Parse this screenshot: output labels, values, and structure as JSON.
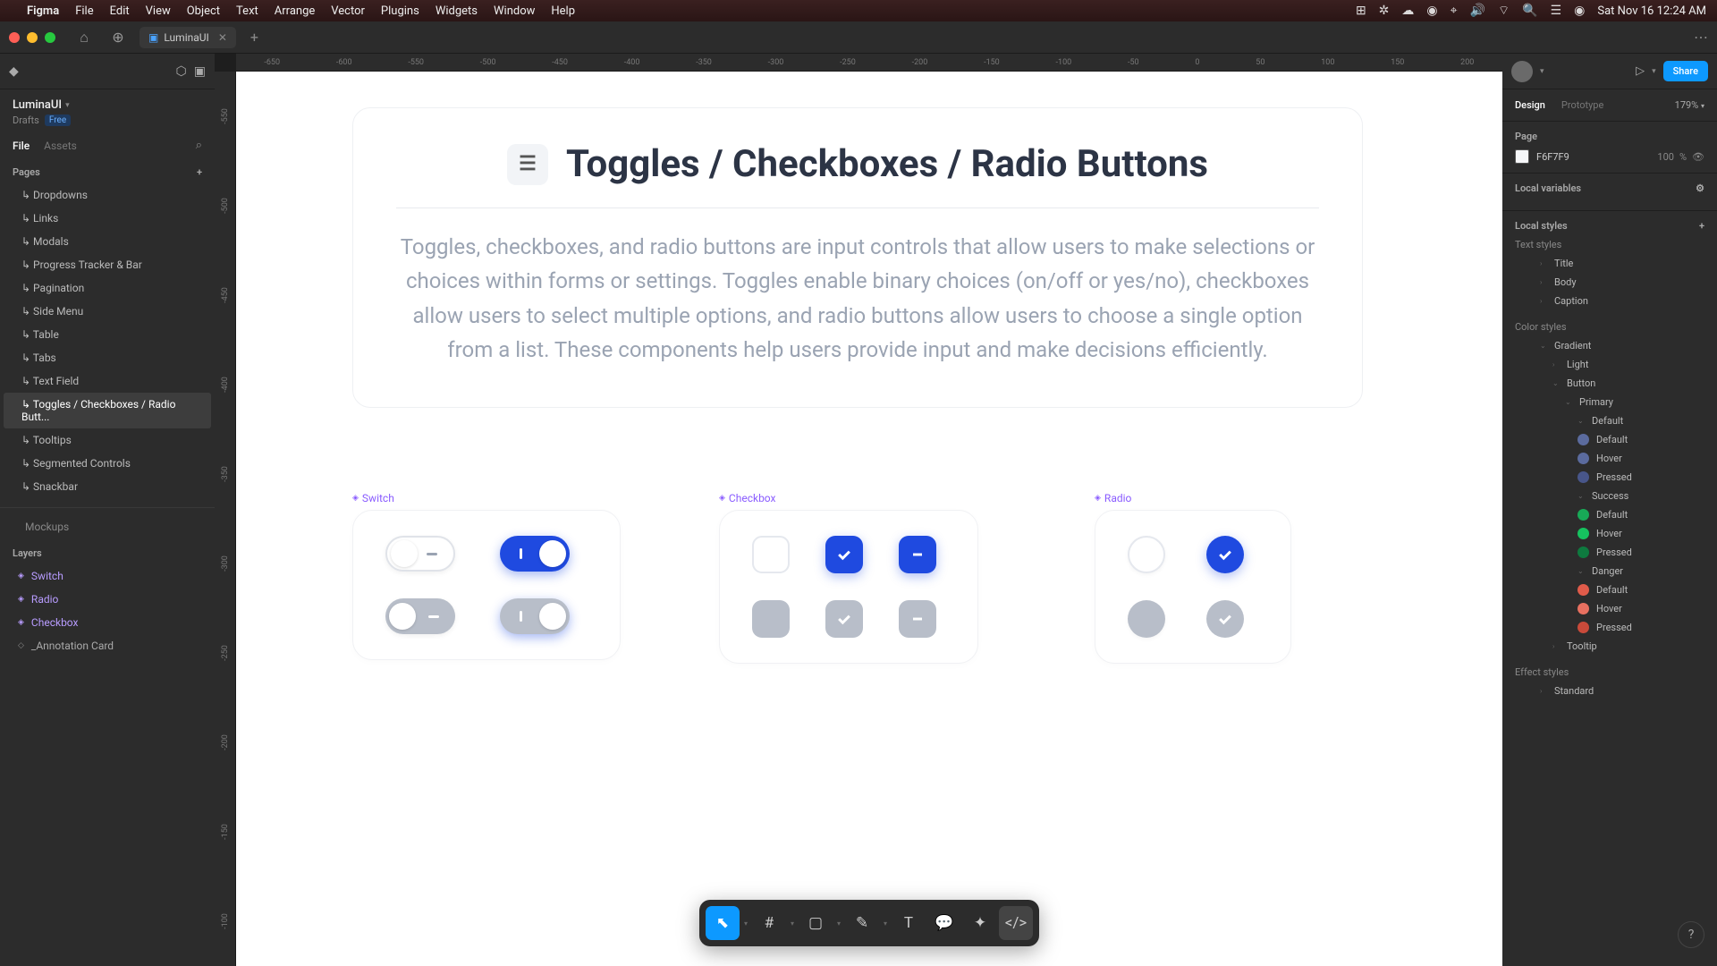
{
  "menubar": {
    "app": "Figma",
    "items": [
      "File",
      "Edit",
      "View",
      "Object",
      "Text",
      "Arrange",
      "Vector",
      "Plugins",
      "Widgets",
      "Window",
      "Help"
    ],
    "clock": "Sat Nov 16  12:24 AM"
  },
  "tab": {
    "name": "LuminaUI"
  },
  "project": {
    "name": "LuminaUI",
    "location": "Drafts",
    "plan": "Free"
  },
  "filetabs": {
    "file": "File",
    "assets": "Assets"
  },
  "pages": {
    "label": "Pages",
    "items": [
      "Dropdowns",
      "Links",
      "Modals",
      "Progress Tracker & Bar",
      "Pagination",
      "Side Menu",
      "Table",
      "Tabs",
      "Text Field",
      "Toggles / Checkboxes / Radio Butt...",
      "Tooltips",
      "Segmented Controls",
      "Snackbar"
    ],
    "active_index": 9,
    "mockups": "Mockups"
  },
  "layers": {
    "label": "Layers",
    "items": [
      "Switch",
      "Radio",
      "Checkbox",
      "_Annotation Card"
    ]
  },
  "ruler_h": [
    "-650",
    "-600",
    "-550",
    "-500",
    "-450",
    "-400",
    "-350",
    "-300",
    "-250",
    "-200",
    "-150",
    "-100",
    "-50",
    "0",
    "50",
    "100",
    "150",
    "200"
  ],
  "ruler_v": [
    "-550",
    "-500",
    "-450",
    "-400",
    "-350",
    "-300",
    "-250",
    "-200",
    "-150",
    "-100"
  ],
  "doc": {
    "title": "Toggles / Checkboxes / Radio Buttons",
    "body": "Toggles, checkboxes, and radio buttons are input controls that allow users to make selections or choices within forms or settings. Toggles enable binary choices (on/off or yes/no), checkboxes allow users to select multiple options, and radio buttons allow users to choose a single option from a list. These components help users provide input and make decisions efficiently."
  },
  "frames": {
    "switch": "Switch",
    "checkbox": "Checkbox",
    "radio": "Radio"
  },
  "right": {
    "design": "Design",
    "prototype": "Prototype",
    "zoom": "179%",
    "page_label": "Page",
    "page_color": "F6F7F9",
    "page_opacity": "100",
    "local_variables": "Local variables",
    "local_styles": "Local styles",
    "text_styles": "Text styles",
    "text_items": [
      "Title",
      "Body",
      "Caption"
    ],
    "color_styles": "Color styles",
    "color_tree": {
      "gradient": "Gradient",
      "light": "Light",
      "button": "Button",
      "primary": "Primary",
      "default_grp": "Default",
      "states": [
        "Default",
        "Hover",
        "Pressed"
      ],
      "success": "Success",
      "danger": "Danger",
      "tooltip": "Tooltip"
    },
    "effect_styles": "Effect styles",
    "effect_items": [
      "Standard"
    ],
    "share": "Share"
  },
  "colors": {
    "primary_default": "#5b6b9e",
    "primary_hover": "#5b6b9e",
    "primary_pressed": "#48568a",
    "success_default": "#18a957",
    "success_hover": "#16c25f",
    "success_pressed": "#0e7a3f",
    "danger_default": "#e05b4a",
    "danger_hover": "#e87060",
    "danger_pressed": "#c94a3a"
  }
}
